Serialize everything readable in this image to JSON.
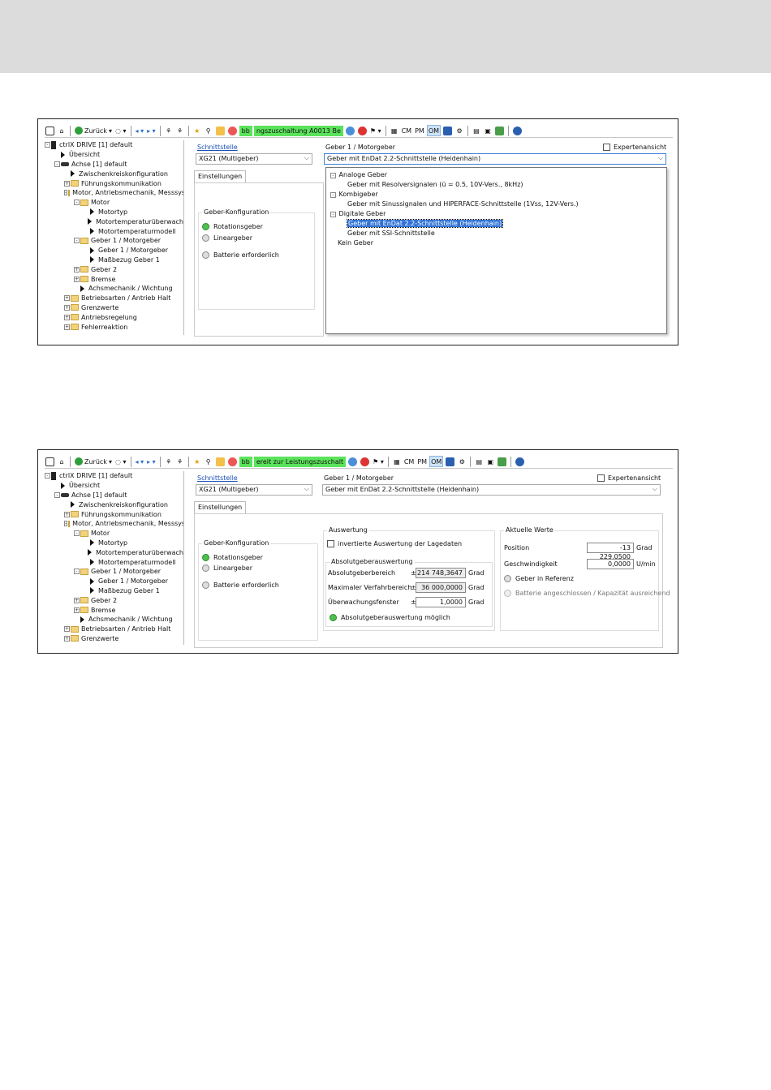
{
  "toolbar": {
    "back_label": "Zurück",
    "green1": "bb",
    "green2_s1": "ngszuschaltung   A0013 Be",
    "green2_s2": "ereit zur Leistungszuschalt",
    "cm": "CM",
    "pm": "PM",
    "om": "OM"
  },
  "tree1": [
    {
      "label": "ctrlX DRIVE [1] default",
      "indent": 0,
      "tw": "-",
      "icon": "drive"
    },
    {
      "label": "Übersicht",
      "indent": 1,
      "tw": "",
      "icon": "tri"
    },
    {
      "label": "Achse [1] default",
      "indent": 1,
      "tw": "-",
      "icon": "axis"
    },
    {
      "label": "Zwischenkreiskonfiguration",
      "indent": 2,
      "tw": "",
      "icon": "tri"
    },
    {
      "label": "Führungskommunikation",
      "indent": 2,
      "tw": "+",
      "icon": "folder"
    },
    {
      "label": "Motor, Antriebsmechanik, Messsys",
      "indent": 2,
      "tw": "-",
      "icon": "folder"
    },
    {
      "label": "Motor",
      "indent": 3,
      "tw": "-",
      "icon": "folder"
    },
    {
      "label": "Motortyp",
      "indent": 4,
      "tw": "",
      "icon": "tri"
    },
    {
      "label": "Motortemperaturüberwach",
      "indent": 4,
      "tw": "",
      "icon": "tri"
    },
    {
      "label": "Motortemperaturmodell",
      "indent": 4,
      "tw": "",
      "icon": "tri"
    },
    {
      "label": "Geber 1 / Motorgeber",
      "indent": 3,
      "tw": "-",
      "icon": "folder"
    },
    {
      "label": "Geber 1 / Motorgeber",
      "indent": 4,
      "tw": "",
      "icon": "tri"
    },
    {
      "label": "Maßbezug Geber 1",
      "indent": 4,
      "tw": "",
      "icon": "tri"
    },
    {
      "label": "Geber 2",
      "indent": 3,
      "tw": "+",
      "icon": "folder"
    },
    {
      "label": "Bremse",
      "indent": 3,
      "tw": "+",
      "icon": "folder"
    },
    {
      "label": "Achsmechanik / Wichtung",
      "indent": 3,
      "tw": "",
      "icon": "tri"
    },
    {
      "label": "Betriebsarten / Antrieb Halt",
      "indent": 2,
      "tw": "+",
      "icon": "folder"
    },
    {
      "label": "Grenzwerte",
      "indent": 2,
      "tw": "+",
      "icon": "folder"
    },
    {
      "label": "Antriebsregelung",
      "indent": 2,
      "tw": "+",
      "icon": "folder"
    },
    {
      "label": "Fehlerreaktion",
      "indent": 2,
      "tw": "+",
      "icon": "folder"
    }
  ],
  "tree2": [
    {
      "label": "ctrlX DRIVE [1] default",
      "indent": 0,
      "tw": "-",
      "icon": "drive"
    },
    {
      "label": "Übersicht",
      "indent": 1,
      "tw": "",
      "icon": "tri"
    },
    {
      "label": "Achse [1] default",
      "indent": 1,
      "tw": "-",
      "icon": "axis"
    },
    {
      "label": "Zwischenkreiskonfiguration",
      "indent": 2,
      "tw": "",
      "icon": "tri"
    },
    {
      "label": "Führungskommunikation",
      "indent": 2,
      "tw": "+",
      "icon": "folder"
    },
    {
      "label": "Motor, Antriebsmechanik, Messsys",
      "indent": 2,
      "tw": "-",
      "icon": "folder"
    },
    {
      "label": "Motor",
      "indent": 3,
      "tw": "-",
      "icon": "folder"
    },
    {
      "label": "Motortyp",
      "indent": 4,
      "tw": "",
      "icon": "tri"
    },
    {
      "label": "Motortemperaturüberwach",
      "indent": 4,
      "tw": "",
      "icon": "tri"
    },
    {
      "label": "Motortemperaturmodell",
      "indent": 4,
      "tw": "",
      "icon": "tri"
    },
    {
      "label": "Geber 1 / Motorgeber",
      "indent": 3,
      "tw": "-",
      "icon": "folder"
    },
    {
      "label": "Geber 1 / Motorgeber",
      "indent": 4,
      "tw": "",
      "icon": "tri"
    },
    {
      "label": "Maßbezug Geber 1",
      "indent": 4,
      "tw": "",
      "icon": "tri"
    },
    {
      "label": "Geber 2",
      "indent": 3,
      "tw": "+",
      "icon": "folder"
    },
    {
      "label": "Bremse",
      "indent": 3,
      "tw": "+",
      "icon": "folder"
    },
    {
      "label": "Achsmechanik / Wichtung",
      "indent": 3,
      "tw": "",
      "icon": "tri"
    },
    {
      "label": "Betriebsarten / Antrieb Halt",
      "indent": 2,
      "tw": "+",
      "icon": "folder"
    },
    {
      "label": "Grenzwerte",
      "indent": 2,
      "tw": "+",
      "icon": "folder"
    }
  ],
  "panel": {
    "schnittstelle_link": "Schnittstelle",
    "interface_value": "XG21 (Multigeber)",
    "encoder_label": "Geber 1 / Motorgeber",
    "encoder_value": "Geber mit EnDat 2.2-Schnittstelle (Heidenhain)",
    "expert_view": "Expertenansicht",
    "tab_settings": "Einstellungen",
    "geber_konfig": "Geber-Konfiguration",
    "rotationsgeber": "Rotationsgeber",
    "lineargeber": "Lineargeber",
    "batterie": "Batterie erforderlich"
  },
  "dropdown": {
    "analog": "Analoge Geber",
    "resolver": "Geber mit Resolversignalen (ü = 0.5, 10V-Vers., 8kHz)",
    "kombi": "Kombigeber",
    "sinus": "Geber mit Sinussignalen und HIPERFACE-Schnittstelle (1Vss, 12V-Vers.)",
    "digital": "Digitale Geber",
    "endat": "Geber mit EnDat 2.2-Schnittstelle (Heidenhain)",
    "ssi": "Geber mit SSI-Schnittstelle",
    "kein": "Kein Geber"
  },
  "auswertung": {
    "title": "Auswertung",
    "invert": "invertierte Auswertung der Lagedaten",
    "abs_title": "Absolutgeberauswertung",
    "bereich_label": "Absolutgeberbereich",
    "bereich_value": "214 748,3647",
    "verfahr_label": "Maximaler Verfahrbereich",
    "verfahr_value": "36 000,0000",
    "fenster_label": "Überwachungsfenster",
    "fenster_value": "1,0000",
    "unit_grad": "Grad",
    "pm": "±",
    "possible": "Absolutgeberauswertung möglich"
  },
  "aktuell": {
    "title": "Aktuelle Werte",
    "position_label": "Position",
    "position_value": "-13 229,0500",
    "position_unit": "Grad",
    "speed_label": "Geschwindigkeit",
    "speed_value": "0,0000",
    "speed_unit": "U/min",
    "referenz": "Geber in Referenz",
    "battery_ok": "Batterie angeschlossen / Kapazität ausreichend"
  },
  "colors": {
    "status_green": "#5be35b",
    "selection": "#3173d6",
    "link": "#1a4fb8"
  }
}
